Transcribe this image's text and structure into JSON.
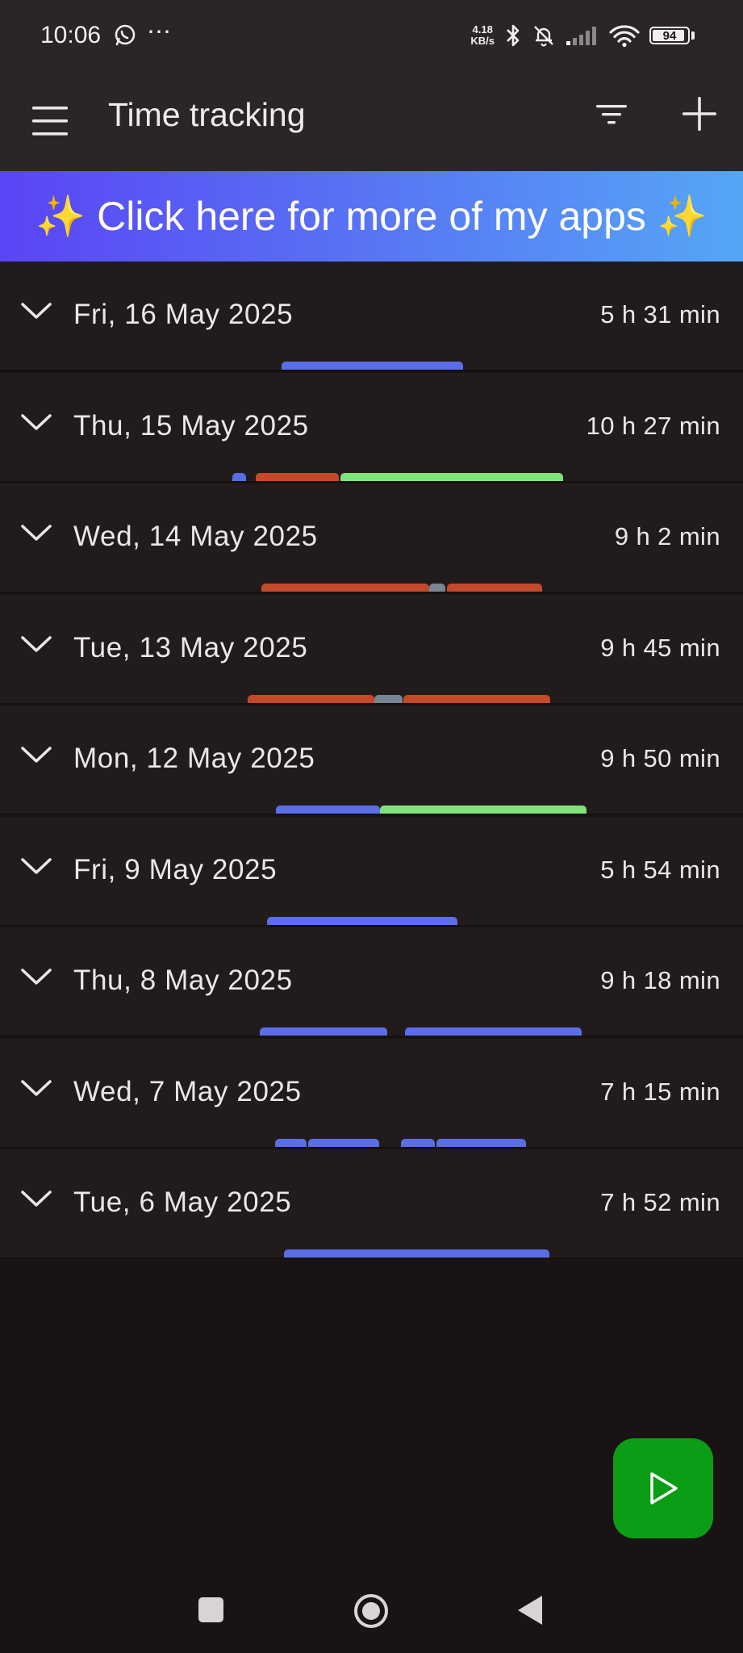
{
  "status_bar": {
    "time": "10:06",
    "notification_icons": [
      "whatsapp-icon",
      "more-dots-icon"
    ],
    "net_speed_value": "4.18",
    "net_speed_unit": "KB/s",
    "system_icons": [
      "bluetooth-icon",
      "bell-off-icon",
      "signal-icon",
      "wifi-icon"
    ],
    "battery": "94"
  },
  "app_bar": {
    "title": "Time tracking",
    "icons": [
      "menu-icon",
      "filter-icon",
      "add-icon"
    ]
  },
  "promo": {
    "text": "✨ Click here for more of my apps ✨"
  },
  "colors": {
    "blue": "#5b6ee8",
    "orange": "#c4492b",
    "green": "#7ee37a",
    "gray": "#7a8593",
    "fab": "#0b9d16"
  },
  "days": [
    {
      "date": "Fri, 16 May 2025",
      "total": "5 h 31 min",
      "segments": [
        {
          "start": 0.3786,
          "end": 0.6233,
          "color": "blue"
        }
      ]
    },
    {
      "date": "Thu, 15 May 2025",
      "total": "10 h 27 min",
      "segments": [
        {
          "start": 0.3125,
          "end": 0.3314,
          "color": "blue"
        },
        {
          "start": 0.3438,
          "end": 0.4563,
          "color": "orange"
        },
        {
          "start": 0.4578,
          "end": 0.7578,
          "color": "green"
        }
      ]
    },
    {
      "date": "Wed, 14 May 2025",
      "total": "9 h 2 min",
      "segments": [
        {
          "start": 0.3521,
          "end": 0.5771,
          "color": "orange"
        },
        {
          "start": 0.5771,
          "end": 0.5999,
          "color": "gray"
        },
        {
          "start": 0.6011,
          "end": 0.7294,
          "color": "orange"
        }
      ]
    },
    {
      "date": "Tue, 13 May 2025",
      "total": "9 h 45 min",
      "segments": [
        {
          "start": 0.3333,
          "end": 0.5033,
          "color": "orange"
        },
        {
          "start": 0.5033,
          "end": 0.5418,
          "color": "gray"
        },
        {
          "start": 0.5429,
          "end": 0.7403,
          "color": "orange"
        }
      ]
    },
    {
      "date": "Mon, 12 May 2025",
      "total": "9 h 50 min",
      "segments": [
        {
          "start": 0.3717,
          "end": 0.5118,
          "color": "blue"
        },
        {
          "start": 0.5118,
          "end": 0.7892,
          "color": "green"
        }
      ]
    },
    {
      "date": "Fri, 9 May 2025",
      "total": "5 h 54 min",
      "segments": [
        {
          "start": 0.3595,
          "end": 0.616,
          "color": "blue"
        }
      ]
    },
    {
      "date": "Thu, 8 May 2025",
      "total": "9 h 18 min",
      "segments": [
        {
          "start": 0.3497,
          "end": 0.5213,
          "color": "blue"
        },
        {
          "start": 0.5452,
          "end": 0.7828,
          "color": "blue"
        }
      ]
    },
    {
      "date": "Wed, 7 May 2025",
      "total": "7 h 15 min",
      "segments": [
        {
          "start": 0.3706,
          "end": 0.4125,
          "color": "blue"
        },
        {
          "start": 0.4148,
          "end": 0.5103,
          "color": "blue"
        },
        {
          "start": 0.5391,
          "end": 0.5853,
          "color": "blue"
        },
        {
          "start": 0.5879,
          "end": 0.708,
          "color": "blue"
        }
      ]
    },
    {
      "date": "Tue, 6 May 2025",
      "total": "7 h 52 min",
      "segments": [
        {
          "start": 0.3825,
          "end": 0.7395,
          "color": "blue"
        }
      ]
    }
  ],
  "fab": {
    "icon": "play-icon"
  },
  "nav_bar": {
    "icons": [
      "recents-square-icon",
      "home-circle-icon",
      "back-triangle-icon"
    ]
  }
}
